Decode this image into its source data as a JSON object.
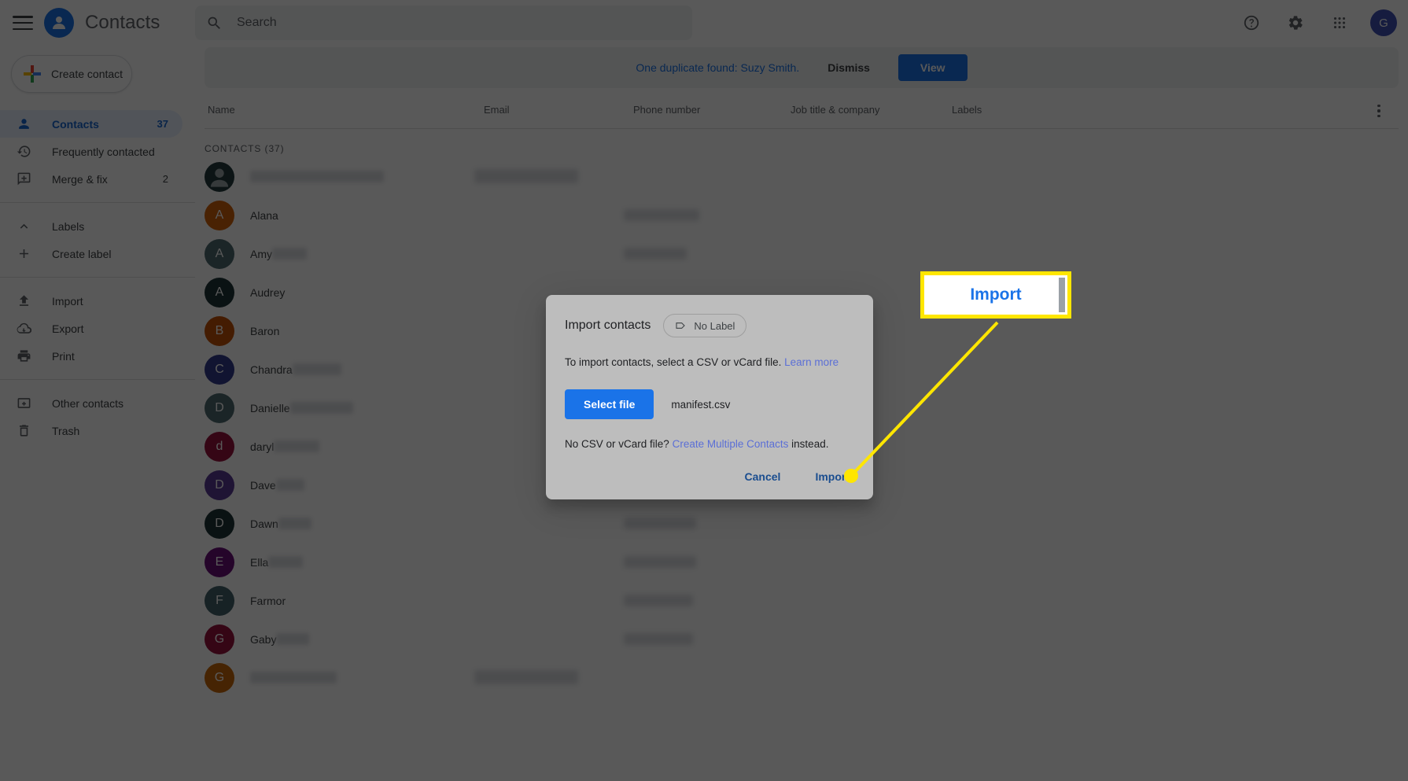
{
  "app": {
    "title": "Contacts",
    "menu_icon": "hamburger-icon",
    "logo_icon": "contacts-person-icon"
  },
  "search": {
    "placeholder": "Search",
    "value": "",
    "icon": "search-icon"
  },
  "topbar_actions": [
    {
      "name": "help-icon",
      "label": "?"
    },
    {
      "name": "settings-gear-icon",
      "label": ""
    },
    {
      "name": "apps-grid-icon",
      "label": ""
    }
  ],
  "account": {
    "initial": "G"
  },
  "sidebar": {
    "create_contact": {
      "label": "Create contact",
      "icon": "plus-multicolor-icon"
    },
    "items": [
      {
        "label": "Contacts",
        "count": "37",
        "icon": "person-icon",
        "active": true
      },
      {
        "label": "Frequently contacted",
        "count": "",
        "icon": "history-clock-icon",
        "active": false
      },
      {
        "label": "Merge & fix",
        "count": "2",
        "icon": "merge-fix-icon",
        "active": false
      },
      {
        "label": "Labels",
        "count": "",
        "icon": "chevron-up-icon",
        "active": false
      },
      {
        "label": "Create label",
        "count": "",
        "icon": "plus-icon",
        "active": false
      },
      {
        "label": "Import",
        "count": "",
        "icon": "import-upload-icon",
        "active": false
      },
      {
        "label": "Export",
        "count": "",
        "icon": "export-cloud-icon",
        "active": false
      },
      {
        "label": "Print",
        "count": "",
        "icon": "printer-icon",
        "active": false
      },
      {
        "label": "Other contacts",
        "count": "",
        "icon": "other-contacts-icon",
        "active": false
      },
      {
        "label": "Trash",
        "count": "",
        "icon": "trash-icon",
        "active": false
      }
    ]
  },
  "banner": {
    "message": "One duplicate found: Suzy Smith.",
    "dismiss_label": "Dismiss",
    "view_label": "View"
  },
  "table": {
    "columns": [
      "Name",
      "Email",
      "Phone number",
      "Job title & company",
      "Labels"
    ],
    "section_label": "CONTACTS (37)",
    "more_icon": "more-vertical-icon",
    "rows": [
      {
        "name": "",
        "initial": "",
        "color": "#233b3e",
        "generic": true,
        "name_redacted": true,
        "phone_redacted": false
      },
      {
        "name": "Alana",
        "initial": "A",
        "color": "#d2610a",
        "generic": false,
        "name_redacted": false,
        "phone_redacted": true
      },
      {
        "name": "Amy",
        "initial": "A",
        "color": "#4d6a70",
        "generic": false,
        "name_redacted": true,
        "phone_redacted": true
      },
      {
        "name": "Audrey",
        "initial": "A",
        "color": "#1f3437",
        "generic": false,
        "name_redacted": false,
        "phone_redacted": false
      },
      {
        "name": "Baron",
        "initial": "B",
        "color": "#c45206",
        "generic": false,
        "name_redacted": false,
        "phone_redacted": false
      },
      {
        "name": "Chandra",
        "initial": "C",
        "color": "#333a8e",
        "generic": false,
        "name_redacted": true,
        "phone_redacted": false
      },
      {
        "name": "Danielle",
        "initial": "D",
        "color": "#4d6a70",
        "generic": false,
        "name_redacted": true,
        "phone_redacted": false
      },
      {
        "name": "daryl",
        "initial": "d",
        "color": "#98123c",
        "generic": false,
        "name_redacted": true,
        "phone_redacted": true
      },
      {
        "name": "Dave",
        "initial": "D",
        "color": "#5b3b94",
        "generic": false,
        "name_redacted": true,
        "phone_redacted": true
      },
      {
        "name": "Dawn",
        "initial": "D",
        "color": "#1f3437",
        "generic": false,
        "name_redacted": true,
        "phone_redacted": true
      },
      {
        "name": "Ella",
        "initial": "E",
        "color": "#6a0f7a",
        "generic": false,
        "name_redacted": true,
        "phone_redacted": true
      },
      {
        "name": "Farmor",
        "initial": "F",
        "color": "#44626a",
        "generic": false,
        "name_redacted": false,
        "phone_redacted": true
      },
      {
        "name": "Gaby",
        "initial": "G",
        "color": "#98123c",
        "generic": false,
        "name_redacted": true,
        "phone_redacted": true
      },
      {
        "name": "",
        "initial": "G",
        "color": "#c9690a",
        "generic": false,
        "name_redacted": true,
        "phone_redacted": false
      }
    ]
  },
  "dialog": {
    "title": "Import contacts",
    "label_chip": {
      "text": "No Label",
      "icon": "label-tag-icon"
    },
    "body_text": "To import contacts, select a CSV or vCard file.",
    "learn_more": "Learn more",
    "select_file_label": "Select file",
    "filename": "manifest.csv",
    "alt_prefix": "No CSV or vCard file?",
    "alt_link": "Create Multiple Contacts",
    "alt_suffix": "instead.",
    "cancel_label": "Cancel",
    "import_label": "Import"
  },
  "annotation": {
    "callout_text": "Import",
    "highlight_color": "#ffe600"
  }
}
